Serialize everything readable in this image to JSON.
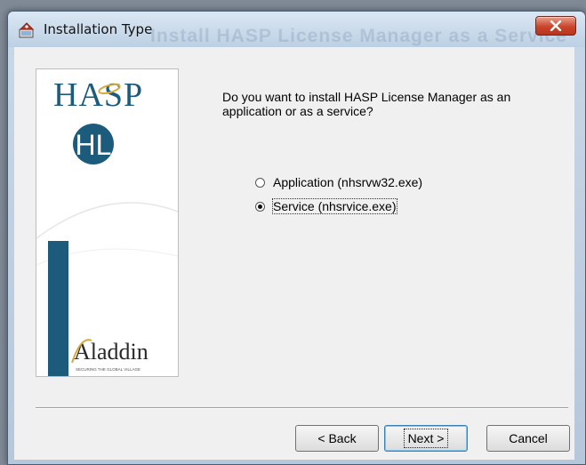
{
  "window": {
    "title": "Installation Type",
    "background_title": "Install HASP License Manager as a Service"
  },
  "logo": {
    "hasp_text": "HASP",
    "hl_text": "HL",
    "brand_text": "Aladdin",
    "brand_tagline": "SECURING THE GLOBAL VILLAGE",
    "accent_color": "#1d5b7c"
  },
  "content": {
    "question_line1": "Do you want to install HASP License Manager as an",
    "question_line2": "application or as a service?",
    "options": [
      {
        "label": "Application (nhsrvw32.exe)",
        "checked": false
      },
      {
        "label": "Service (nhsrvice.exe)",
        "checked": true
      }
    ]
  },
  "buttons": {
    "back": "< Back",
    "next": "Next >",
    "cancel": "Cancel"
  }
}
